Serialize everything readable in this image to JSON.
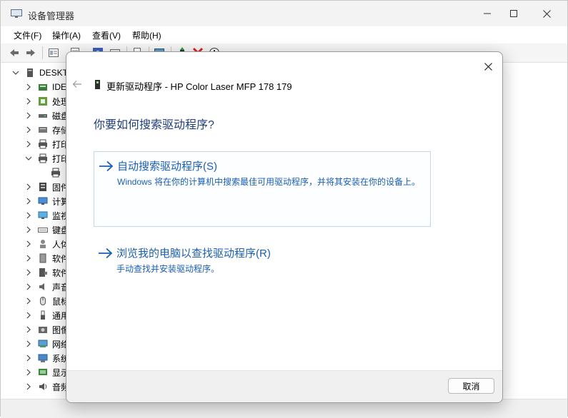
{
  "window": {
    "title": "设备管理器"
  },
  "menu": [
    "文件(F)",
    "操作(A)",
    "查看(V)",
    "帮助(H)"
  ],
  "toolbar_icons": [
    "back-icon",
    "forward-icon",
    "properties-icon",
    "driver-icon",
    "help-icon",
    "scan-icon",
    "monitor-icon",
    "update-driver-icon",
    "uninstall-icon",
    "disable-icon"
  ],
  "tree": {
    "root": "DESKT",
    "categories": [
      {
        "label": "IDE",
        "icon": "ide-icon",
        "expanded": false
      },
      {
        "label": "处理",
        "icon": "processor-icon",
        "expanded": false
      },
      {
        "label": "磁盘",
        "icon": "disk-icon",
        "expanded": false
      },
      {
        "label": "存储",
        "icon": "storage-icon",
        "expanded": false
      },
      {
        "label": "打印",
        "icon": "printer-icon",
        "expanded": false
      },
      {
        "label": "打印",
        "icon": "printer-icon",
        "expanded": true,
        "child": ""
      },
      {
        "label": "固件",
        "icon": "firmware-icon",
        "expanded": false
      },
      {
        "label": "计算",
        "icon": "computer-icon",
        "expanded": false
      },
      {
        "label": "监视",
        "icon": "monitor-icon",
        "expanded": false
      },
      {
        "label": "键盘",
        "icon": "keyboard-icon",
        "expanded": false
      },
      {
        "label": "人体",
        "icon": "hid-icon",
        "expanded": false
      },
      {
        "label": "软件",
        "icon": "software-icon",
        "expanded": false
      },
      {
        "label": "软件",
        "icon": "software-component-icon",
        "expanded": false
      },
      {
        "label": "声音",
        "icon": "sound-icon",
        "expanded": false
      },
      {
        "label": "鼠标",
        "icon": "mouse-icon",
        "expanded": false
      },
      {
        "label": "通用",
        "icon": "usb-icon",
        "expanded": false
      },
      {
        "label": "图像",
        "icon": "imaging-icon",
        "expanded": false
      },
      {
        "label": "网络",
        "icon": "network-icon",
        "expanded": false
      },
      {
        "label": "系统",
        "icon": "system-icon",
        "expanded": false
      },
      {
        "label": "显示",
        "icon": "display-icon",
        "expanded": false
      },
      {
        "label": "音频",
        "icon": "audio-icon",
        "expanded": false
      }
    ]
  },
  "dialog": {
    "title": "更新驱动程序 - HP Color Laser MFP 178 179",
    "heading": "你要如何搜索驱动程序?",
    "options": [
      {
        "title": "自动搜索驱动程序(S)",
        "description": "Windows 将在你的计算机中搜索最佳可用驱动程序，并将其安装在你的设备上。"
      },
      {
        "title": "浏览我的电脑以查找驱动程序(R)",
        "description": "手动查找并安装驱动程序。"
      }
    ],
    "cancel_label": "取消"
  },
  "colors": {
    "accent": "#1a5fb4",
    "heading": "#1f3d7a",
    "selected_border": "#c3d7ee"
  }
}
